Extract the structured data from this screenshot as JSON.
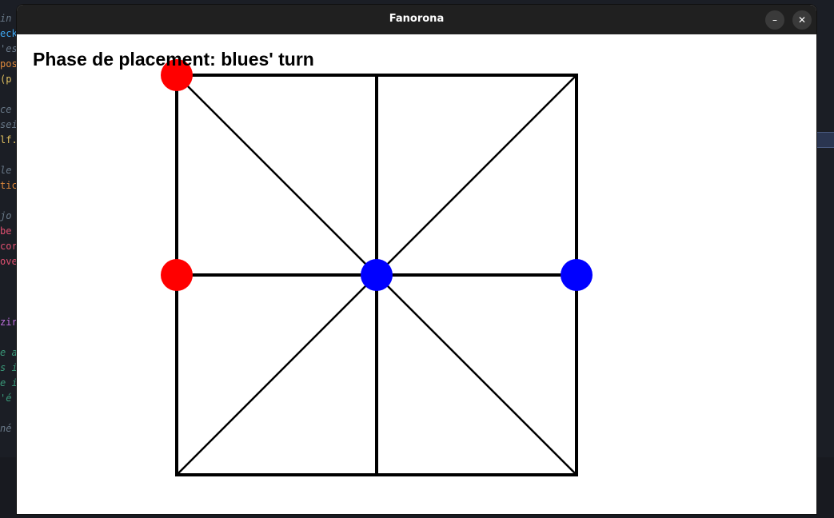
{
  "window": {
    "title": "Fanorona",
    "minimize_glyph": "–",
    "close_glyph": "✕"
  },
  "game": {
    "status_text": "Phase de placement: blues' turn",
    "board": {
      "grid": [
        3,
        3
      ],
      "line_color": "#000000",
      "lines": [
        {
          "from": [
            0,
            0
          ],
          "to": [
            2,
            0
          ]
        },
        {
          "from": [
            0,
            1
          ],
          "to": [
            2,
            1
          ]
        },
        {
          "from": [
            0,
            2
          ],
          "to": [
            2,
            2
          ]
        },
        {
          "from": [
            0,
            0
          ],
          "to": [
            0,
            2
          ]
        },
        {
          "from": [
            1,
            0
          ],
          "to": [
            1,
            2
          ]
        },
        {
          "from": [
            2,
            0
          ],
          "to": [
            2,
            2
          ]
        },
        {
          "from": [
            0,
            0
          ],
          "to": [
            2,
            2
          ]
        },
        {
          "from": [
            2,
            0
          ],
          "to": [
            0,
            2
          ]
        }
      ],
      "pieces": [
        {
          "col": 0,
          "row": 0,
          "color": "red"
        },
        {
          "col": 0,
          "row": 1,
          "color": "red"
        },
        {
          "col": 1,
          "row": 1,
          "color": "blue"
        },
        {
          "col": 2,
          "row": 1,
          "color": "blue"
        }
      ]
    },
    "colors": {
      "red": "#ff0000",
      "blue": "#0000ff"
    }
  },
  "background_editor": {
    "visible_fragments": [
      {
        "text": " in",
        "color": "#6a7a8a"
      },
      {
        "text": "eck",
        "color": "#3fa9f5"
      },
      {
        "text": "'es",
        "color": "#6a7a8a"
      },
      {
        "text": "pos",
        "color": "#e08a3c"
      },
      {
        "text": " (p",
        "color": "#e0c060"
      },
      {
        "text": "ce ",
        "color": "#6a7a8a"
      },
      {
        "text": "sei",
        "color": "#6a7a8a"
      },
      {
        "text": "lf.",
        "color": "#e0c060"
      },
      {
        "text": "le ",
        "color": "#6a7a8a"
      },
      {
        "text": "tic",
        "color": "#e08a3c"
      },
      {
        "text": " jo",
        "color": "#6a7a8a"
      },
      {
        "text": " be",
        "color": "#e05070"
      },
      {
        "text": "cor",
        "color": "#e05070"
      },
      {
        "text": "ove",
        "color": "#e05070"
      },
      {
        "text": "zir",
        "color": "#c070e0"
      },
      {
        "text": "e a",
        "color": "#3a9a7a"
      },
      {
        "text": "s i",
        "color": "#3a9a7a"
      },
      {
        "text": "e i",
        "color": "#3a9a7a"
      },
      {
        "text": "'é",
        "color": "#3a9a7a"
      },
      {
        "text": "né",
        "color": "#6a7a8a"
      }
    ]
  }
}
